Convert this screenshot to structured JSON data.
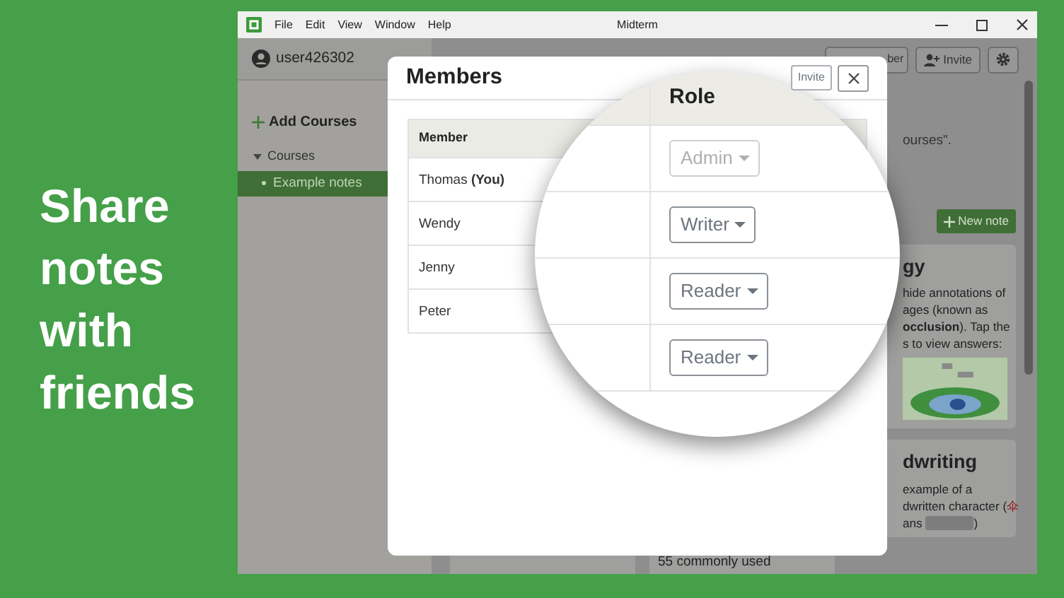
{
  "slogan": "Share notes with friends",
  "window": {
    "title": "Midterm",
    "menu": [
      "File",
      "Edit",
      "View",
      "Window",
      "Help"
    ]
  },
  "sidebar": {
    "user": "user426302",
    "add_action": "Add Courses",
    "section": {
      "label": "Courses",
      "expanded": true,
      "items": [
        {
          "label": "Example notes",
          "selected": true
        }
      ]
    }
  },
  "toolbar": {
    "buttons": [
      {
        "kind": "text",
        "label": "ber"
      },
      {
        "kind": "invite",
        "label": "Invite"
      },
      {
        "kind": "settings"
      }
    ]
  },
  "main": {
    "notice": "ourses\".",
    "new_note": "New note",
    "cards": [
      {
        "kind": "image",
        "title": "gy",
        "lines": [
          {
            "text": "hide annotations of"
          },
          {
            "text": "ages (known as"
          },
          {
            "text": "**occlusion**). Tap the"
          },
          {
            "text": "s to view answers:"
          }
        ]
      },
      {
        "kind": "text",
        "title": "dwriting",
        "lines": [
          {
            "text": "example of a"
          },
          {
            "text": "dwritten character (",
            "accent": "伞"
          },
          {
            "text": "ans",
            "blank": true,
            "after": ")"
          }
        ]
      }
    ],
    "bottom_card_text": "55 commonly used"
  },
  "dialog": {
    "title": "Members",
    "invite": "Invite",
    "column": "Member",
    "members": [
      "Thomas **(You)**",
      "Wendy",
      "Jenny",
      "Peter"
    ]
  },
  "magnifier": {
    "column": "Role",
    "roles": [
      {
        "label": "Admin",
        "disabled": true
      },
      {
        "label": "Writer",
        "disabled": false
      },
      {
        "label": "Reader",
        "disabled": false
      },
      {
        "label": "Reader",
        "disabled": false
      }
    ]
  }
}
